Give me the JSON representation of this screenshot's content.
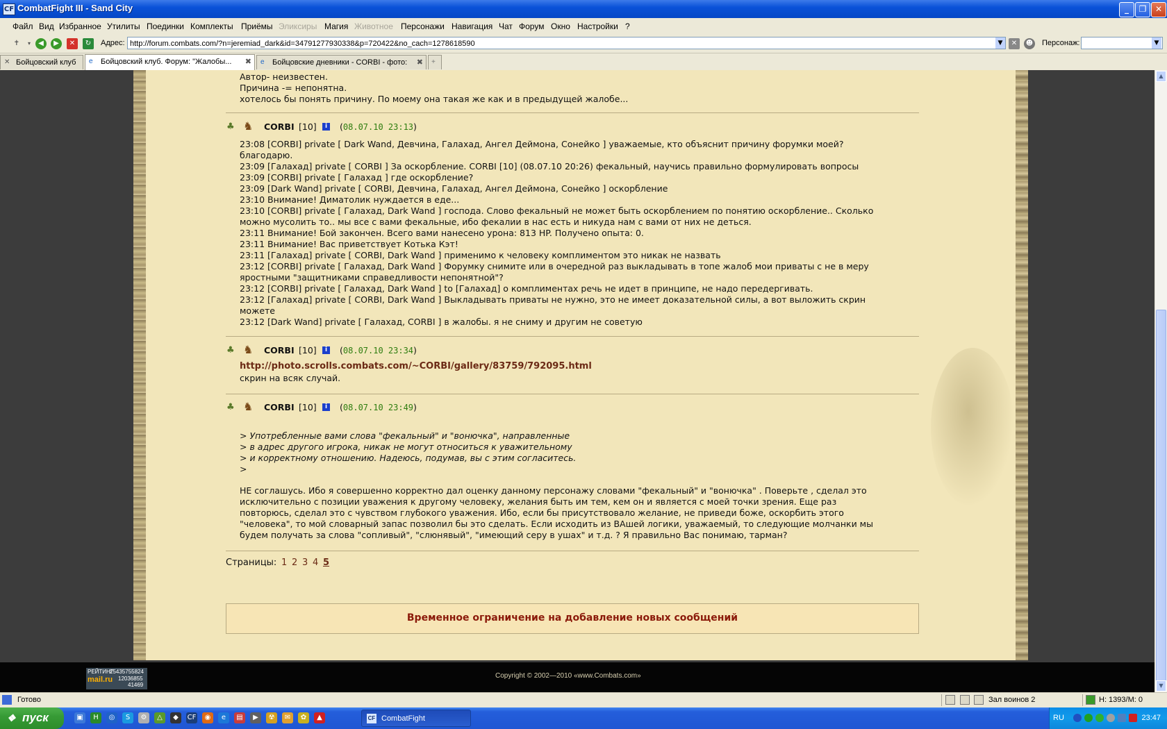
{
  "window": {
    "title": "CombatFight III - Sand City",
    "min": "_",
    "max": "❐",
    "close": "✕"
  },
  "menu": [
    "Файл",
    "Вид",
    "Избранное",
    "Утилиты",
    "Поединки",
    "Комплекты",
    "Приёмы",
    "Эликсиры",
    "Магия",
    "Животное",
    "Персонажи",
    "Навигация",
    "Чат",
    "Форум",
    "Окно",
    "Настройки",
    "?"
  ],
  "address": {
    "label": "Адрес:",
    "url": "http://forum.combats.com/?n=jeremiad_dark&id=34791277930338&p=720422&no_cach=1278618590",
    "persona_label": "Персонаж:"
  },
  "tabs": [
    {
      "label": "Бойцовский клуб"
    },
    {
      "label": "Бойцовский клуб. Форум: \"Жалобы..."
    },
    {
      "label": "Бойцовские дневники - CORBI - фото:"
    }
  ],
  "forum": {
    "top_lines": [
      "Автор- неизвестен.",
      "Причина -= непонятна.",
      "хотелось бы понять причину. По моему она такая же как и в предыдущей жалобе..."
    ],
    "posts": [
      {
        "author": "CORBI",
        "level": "[10]",
        "date": "08.07.10 23:13",
        "lines": [
          "23:08 [CORBI] private [ Dark Wand, Девчина, Галахад, Ангел Деймона, Сонейко ] уважаемые, кто объяснит причину форумки моей?",
          "благодарю.",
          "23:09 [Галахад] private [ CORBI ] За оскорбление. CORBI [10] (08.07.10 20:26) фекальный, научись правильно формулировать вопросы",
          "23:09 [CORBI] private [ Галахад ] где оскорбление?",
          "23:09 [Dark Wand] private [ CORBI, Девчина, Галахад, Ангел Деймона, Сонейко ] оскорбление",
          "23:10 Внимание! Диматолик нуждается в еде...",
          "23:10 [CORBI] private [ Галахад, Dark Wand ] господа. Слово фекальный не может быть оскорблением по понятию оскорбление.. Сколько",
          "можно мусолить то.. мы все с вами фекальные, ибо фекалии в нас есть и никуда нам с вами от них не деться.",
          "23:11 Внимание! Бой закончен. Всего вами нанесено урона: 813 HP. Получено опыта: 0.",
          "23:11 Внимание! Вас приветствует Котька Кэт!",
          "23:11 [Галахад] private [ CORBI, Dark Wand ] применимо к человеку комплиментом это никак не назвать",
          "23:12 [CORBI] private [ Галахад, Dark Wand ] Форумку снимите или в очередной раз выкладывать в топе жалоб мои приваты с не в меру",
          "яростными \"защитниками справедливости непонятной\"?",
          "23:12 [CORBI] private [ Галахад, Dark Wand ] to [Галахад] о комплиментах речь не идет в принципе, не надо передергивать.",
          "23:12 [Галахад] private [ CORBI, Dark Wand ] Выкладывать приваты не нужно, это не имеет доказательной силы, а вот выложить скрин",
          "можете",
          "23:12 [Dark Wand] private [ Галахад, CORBI ] в жалобы. я не сниму и другим не советую"
        ]
      },
      {
        "author": "CORBI",
        "level": "[10]",
        "date": "08.07.10 23:34",
        "link": "http://photo.scrolls.combats.com/~CORBI/gallery/83759/792095.html",
        "lines": [
          "скрин на всяк случай."
        ]
      },
      {
        "author": "CORBI",
        "level": "[10]",
        "date": "08.07.10 23:49",
        "quote": [
          "> Употребленные вами слова \"фекальный\" и \"вонючка\", направленные",
          "> в адрес другого игрока, никак не могут относиться к уважительному",
          "> и корректному отношению. Надеюсь, подумав, вы с этим согласитесь.",
          ">"
        ],
        "lines": [
          "НЕ соглашусь. Ибо я совершенно корректно дал оценку данному персонажу словами \"фекальный\" и \"вонючка\" . Поверьте , сделал это",
          "исключительно с позиции уважения к другому человеку, желания быть им тем, кем он и является с моей точки зрения. Еще раз",
          "повторюсь, сделал это с чувством глубокого уважения. Ибо, если бы присутствовало желание, не приведи боже, оскорбить этого",
          "\"человека\", то мой словарный запас позволил бы это сделать. Если исходить из ВАшей логики, уважаемый, то следующие молчанки мы",
          "будем получать за слова \"сопливый\", \"слюнявый\", \"имеющий серу в ушах\" и т.д. ? Я правильно Вас понимаю, тарман?"
        ]
      }
    ],
    "pages_label": "Страницы:",
    "pages": [
      "1",
      "2",
      "3",
      "4",
      "5"
    ],
    "current_page": "5",
    "notice": "Временное ограничение на добавление новых сообщений",
    "copyright": "Copyright © 2002—2010 «www.Combats.com»",
    "counter": [
      "РЕЙТИНГ",
      "25435755824",
      "mail.ru",
      "12036855",
      "41469"
    ]
  },
  "status": {
    "text": "Готово",
    "zone": "Зал воинов 2",
    "hp": "Н: 1393/М: 0"
  },
  "taskbar": {
    "start": "пуск",
    "window_button": "CombatFight",
    "lang": "RU",
    "time": "23:47"
  }
}
